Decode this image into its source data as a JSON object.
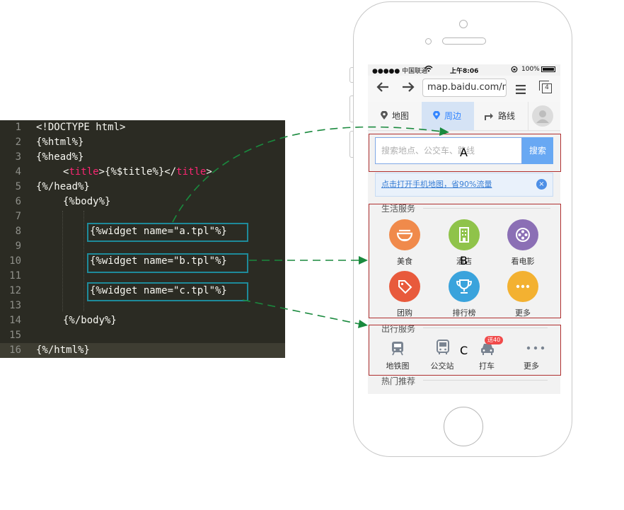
{
  "editor": {
    "lines": [
      {
        "num": "1",
        "text": "<!DOCTYPE html>"
      },
      {
        "num": "2",
        "text": "{%html%}"
      },
      {
        "num": "3",
        "text": "{%head%}"
      },
      {
        "num": "4",
        "pre": "<",
        "tag": "title",
        "mid": ">{%$title%}</",
        "tag2": "title",
        "post": ">"
      },
      {
        "num": "5",
        "text": "{%/head%}"
      },
      {
        "num": "6",
        "text": "{%body%}"
      },
      {
        "num": "7",
        "text": ""
      },
      {
        "num": "8",
        "text": "{%widget name=\"a.tpl\"%}"
      },
      {
        "num": "9",
        "text": ""
      },
      {
        "num": "10",
        "text": "{%widget name=\"b.tpl\"%}"
      },
      {
        "num": "11",
        "text": ""
      },
      {
        "num": "12",
        "text": "{%widget name=\"c.tpl\"%}"
      },
      {
        "num": "13",
        "text": ""
      },
      {
        "num": "14",
        "text": "{%/body%}"
      },
      {
        "num": "15",
        "text": ""
      },
      {
        "num": "16",
        "text": "{%/html%}"
      }
    ],
    "colors": {
      "background": "#2b2b23",
      "tag": "#f92672",
      "box": "#1e8a9a"
    }
  },
  "phone": {
    "status": {
      "carrier": "●●●●● 中国联通",
      "time": "上午8:06",
      "battery": "100%"
    },
    "browser": {
      "url": "map.baidu.com/m",
      "back_icon": "arrow-left-icon",
      "forward_icon": "arrow-right-icon",
      "menu_icon": "menu-icon",
      "tabs_count": "4"
    },
    "tabs": [
      {
        "label": "地图",
        "icon": "pin-icon"
      },
      {
        "label": "周边",
        "icon": "nearby-pin-icon",
        "active": true
      },
      {
        "label": "路线",
        "icon": "route-icon"
      }
    ],
    "search": {
      "placeholder": "搜索地点、公交车、路线",
      "button": "搜索"
    },
    "banner": {
      "text": "点击打开手机地图，省90%流量",
      "close": "×"
    },
    "life": {
      "title": "生活服务",
      "items": [
        {
          "label": "美食",
          "color": "#f08a4b",
          "icon": "bowl-icon"
        },
        {
          "label": "酒店",
          "color": "#8fc34a",
          "icon": "building-icon"
        },
        {
          "label": "看电影",
          "color": "#8b6fb5",
          "icon": "film-icon"
        },
        {
          "label": "团购",
          "color": "#e85a3c",
          "icon": "tag-icon"
        },
        {
          "label": "排行榜",
          "color": "#3aa3dc",
          "icon": "trophy-icon"
        },
        {
          "label": "更多",
          "color": "#f3b131",
          "icon": "more-icon"
        }
      ]
    },
    "trip": {
      "title": "出行服务",
      "items": [
        {
          "label": "地铁图",
          "icon": "subway-icon"
        },
        {
          "label": "公交站",
          "icon": "bus-icon"
        },
        {
          "label": "打车",
          "icon": "taxi-icon",
          "badge": "送40"
        },
        {
          "label": "更多",
          "icon": "more-dots-icon"
        }
      ]
    },
    "hot": {
      "title": "热门推荐"
    }
  },
  "regions": {
    "a": "A",
    "b": "B",
    "c": "C"
  },
  "colors": {
    "region_box": "#b03030",
    "arrow": "#1a8a3e",
    "accent": "#3385ff"
  }
}
